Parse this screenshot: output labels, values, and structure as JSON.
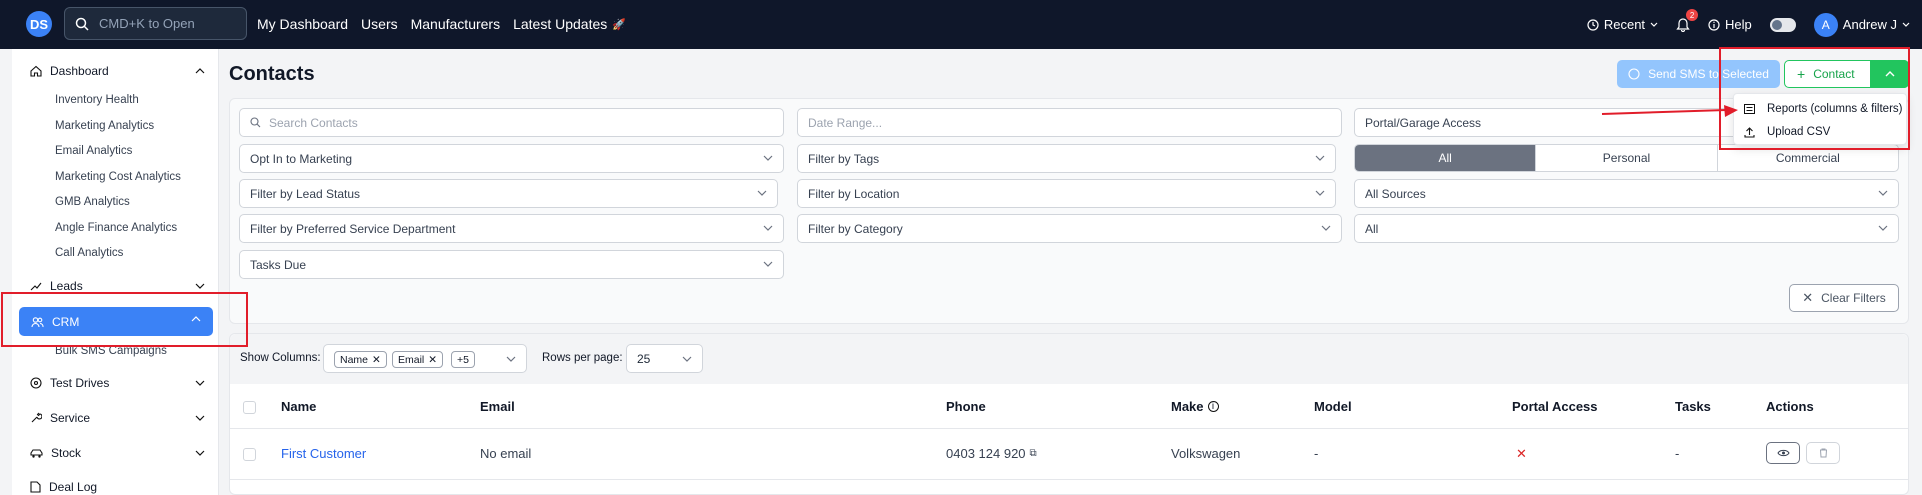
{
  "topbar": {
    "logo": "DS",
    "search_placeholder": "CMD+K to Open",
    "nav": [
      "My Dashboard",
      "Users",
      "Manufacturers",
      "Latest Updates"
    ],
    "recent": "Recent",
    "notifications": "2",
    "help": "Help",
    "toggle_icon": "moon-icon",
    "avatar_initial": "A",
    "user": "Andrew J"
  },
  "sidebar": {
    "dashboard": "Dashboard",
    "dashboard_items": [
      "Inventory Health",
      "Marketing Analytics",
      "Email Analytics",
      "Marketing Cost Analytics",
      "GMB Analytics",
      "Angle Finance Analytics",
      "Call Analytics"
    ],
    "leads": "Leads",
    "crm": "CRM",
    "crm_items": [
      "Bulk SMS Campaigns"
    ],
    "test_drives": "Test Drives",
    "service": "Service",
    "stock": "Stock",
    "deal_log": "Deal Log"
  },
  "page": {
    "title": "Contacts",
    "send_sms": "Send SMS to Selected",
    "contact": "Contact"
  },
  "menu": {
    "reports": "Reports (columns & filters)",
    "upload": "Upload CSV"
  },
  "filters": {
    "search_placeholder": "Search Contacts",
    "date_placeholder": "Date Range...",
    "portal": "Portal/Garage Access",
    "opt_in": "Opt In to Marketing",
    "tags": "Filter by Tags",
    "lead_status": "Filter by Lead Status",
    "location": "Filter by Location",
    "sources": "All Sources",
    "preferred_dept": "Filter by Preferred Service Department",
    "category": "Filter by Category",
    "all_select": "All",
    "tasks_due": "Tasks Due",
    "segment": [
      "All",
      "Personal",
      "Commercial"
    ],
    "clear": "Clear Filters"
  },
  "table": {
    "show_columns": "Show Columns:",
    "chips": [
      "Name",
      "Email",
      "+5"
    ],
    "rows_per_page_label": "Rows per page:",
    "rows_per_page": "25",
    "headers": [
      "Name",
      "Email",
      "Phone",
      "Make",
      "Model",
      "Portal Access",
      "Tasks",
      "Actions"
    ],
    "rows": [
      {
        "name": "First Customer",
        "email": "No email",
        "phone": "0403 124 920",
        "make": "Volkswagen",
        "model": "-",
        "portal": "✕",
        "tasks": "-"
      }
    ]
  },
  "colors": {
    "accent": "#3b82f6",
    "green": "#22c55e",
    "annotation": "#e11d2a",
    "topbar": "#0f172a"
  }
}
